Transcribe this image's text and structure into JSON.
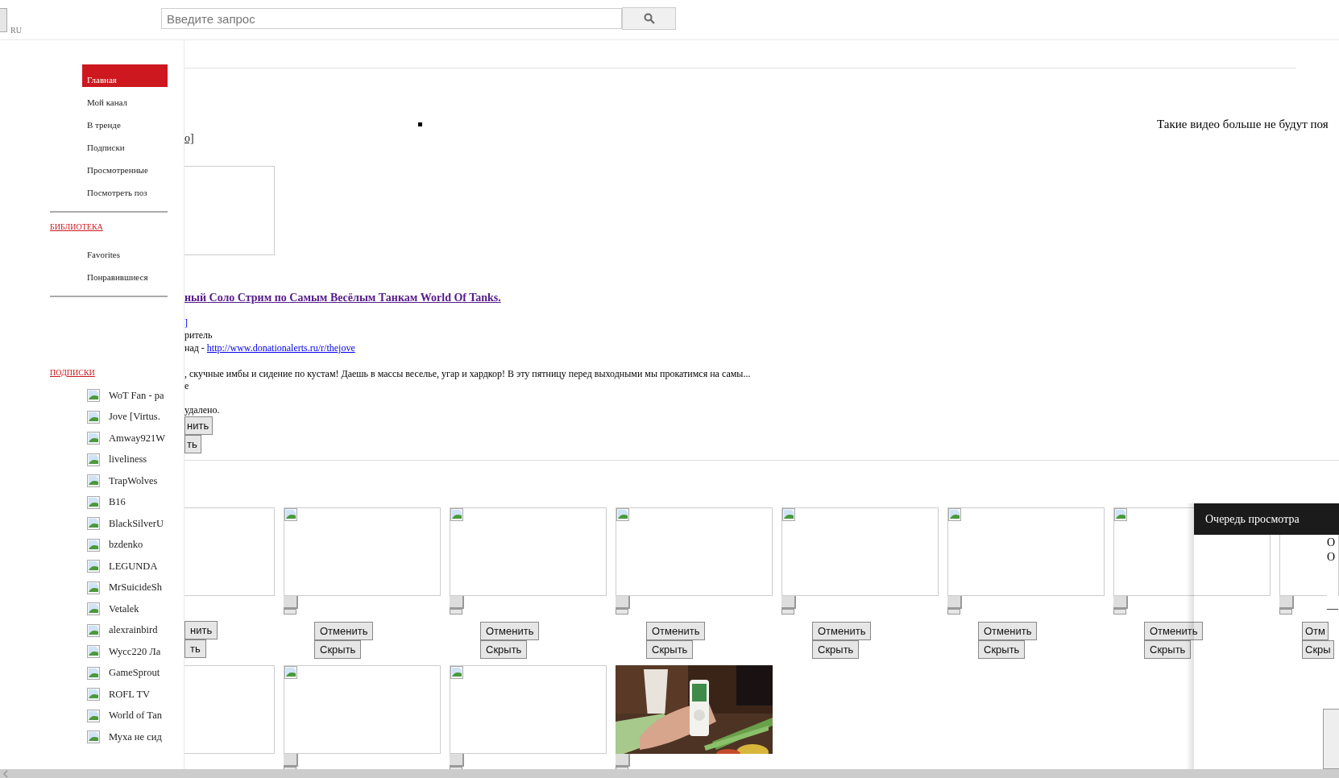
{
  "header": {
    "locale": "RU",
    "search": {
      "placeholder": "Введите запрос"
    }
  },
  "sidebar": {
    "nav": [
      {
        "label": "Главная",
        "selected": true
      },
      {
        "label": "Мой канал",
        "selected": false
      },
      {
        "label": "В тренде",
        "selected": false
      },
      {
        "label": "Подписки",
        "selected": false
      },
      {
        "label": "Просмотренные",
        "selected": false
      },
      {
        "label": "Посмотреть поз",
        "selected": false
      }
    ],
    "library": {
      "heading": "БИБЛИОТЕКА",
      "items": [
        "Favorites",
        "Понравившиеся"
      ]
    },
    "subscriptions": {
      "heading": "ПОДПИСКИ",
      "items": [
        "WoT Fan - pa",
        "Jove [Virtus.",
        "Amway921W",
        "liveliness",
        "TrapWolves",
        "B16",
        "BlackSilverU",
        "bzdenko",
        "LEGUNDA",
        "MrSuicideSh",
        "Vetalek",
        "alexrainbird",
        "Wycc220 Ла",
        "GameSprout",
        "ROFL TV",
        "World of Tan",
        "Муха не сид"
      ]
    }
  },
  "notice": "Такие видео больше не будут поя",
  "featured": {
    "bracket": "о]",
    "title": "ный Соло Стрим по Самым Весёлым Танкам World Of Tanks.",
    "channel_link": "]",
    "role": "ритель",
    "donation_prefix": "над - ",
    "donation_link": "http://www.donationalerts.ru/r/thejove",
    "description": ", скучные имбы и сидение по кустам! Даешь в массы веселье, угар и хардкор! В эту пятницу перед выходными мы прокатимся на самы...",
    "more": "е",
    "removed": "удалено.",
    "cancel": "нить",
    "hide": "ть"
  },
  "grid": {
    "rows": [
      [
        {
          "kind": "blank",
          "cancel": "нить",
          "hide": "ть"
        },
        {
          "kind": "broken",
          "cancel": "Отменить",
          "hide": "Скрыть"
        },
        {
          "kind": "broken",
          "cancel": "Отменить",
          "hide": "Скрыть"
        },
        {
          "kind": "broken",
          "cancel": "Отменить",
          "hide": "Скрыть"
        },
        {
          "kind": "broken",
          "cancel": "Отменить",
          "hide": "Скрыть"
        },
        {
          "kind": "broken",
          "cancel": "Отменить",
          "hide": "Скрыть"
        },
        {
          "kind": "broken",
          "cancel": "Отменить",
          "hide": "Скрыть"
        },
        {
          "kind": "plain",
          "cancel": "Отм",
          "hide": "Скры"
        }
      ],
      [
        {
          "kind": "blank"
        },
        {
          "kind": "broken"
        },
        {
          "kind": "broken"
        },
        {
          "kind": "picture"
        }
      ]
    ]
  },
  "queue": {
    "title": "Очередь просмотра",
    "lines": [
      "О",
      "О"
    ],
    "dash": "—"
  }
}
